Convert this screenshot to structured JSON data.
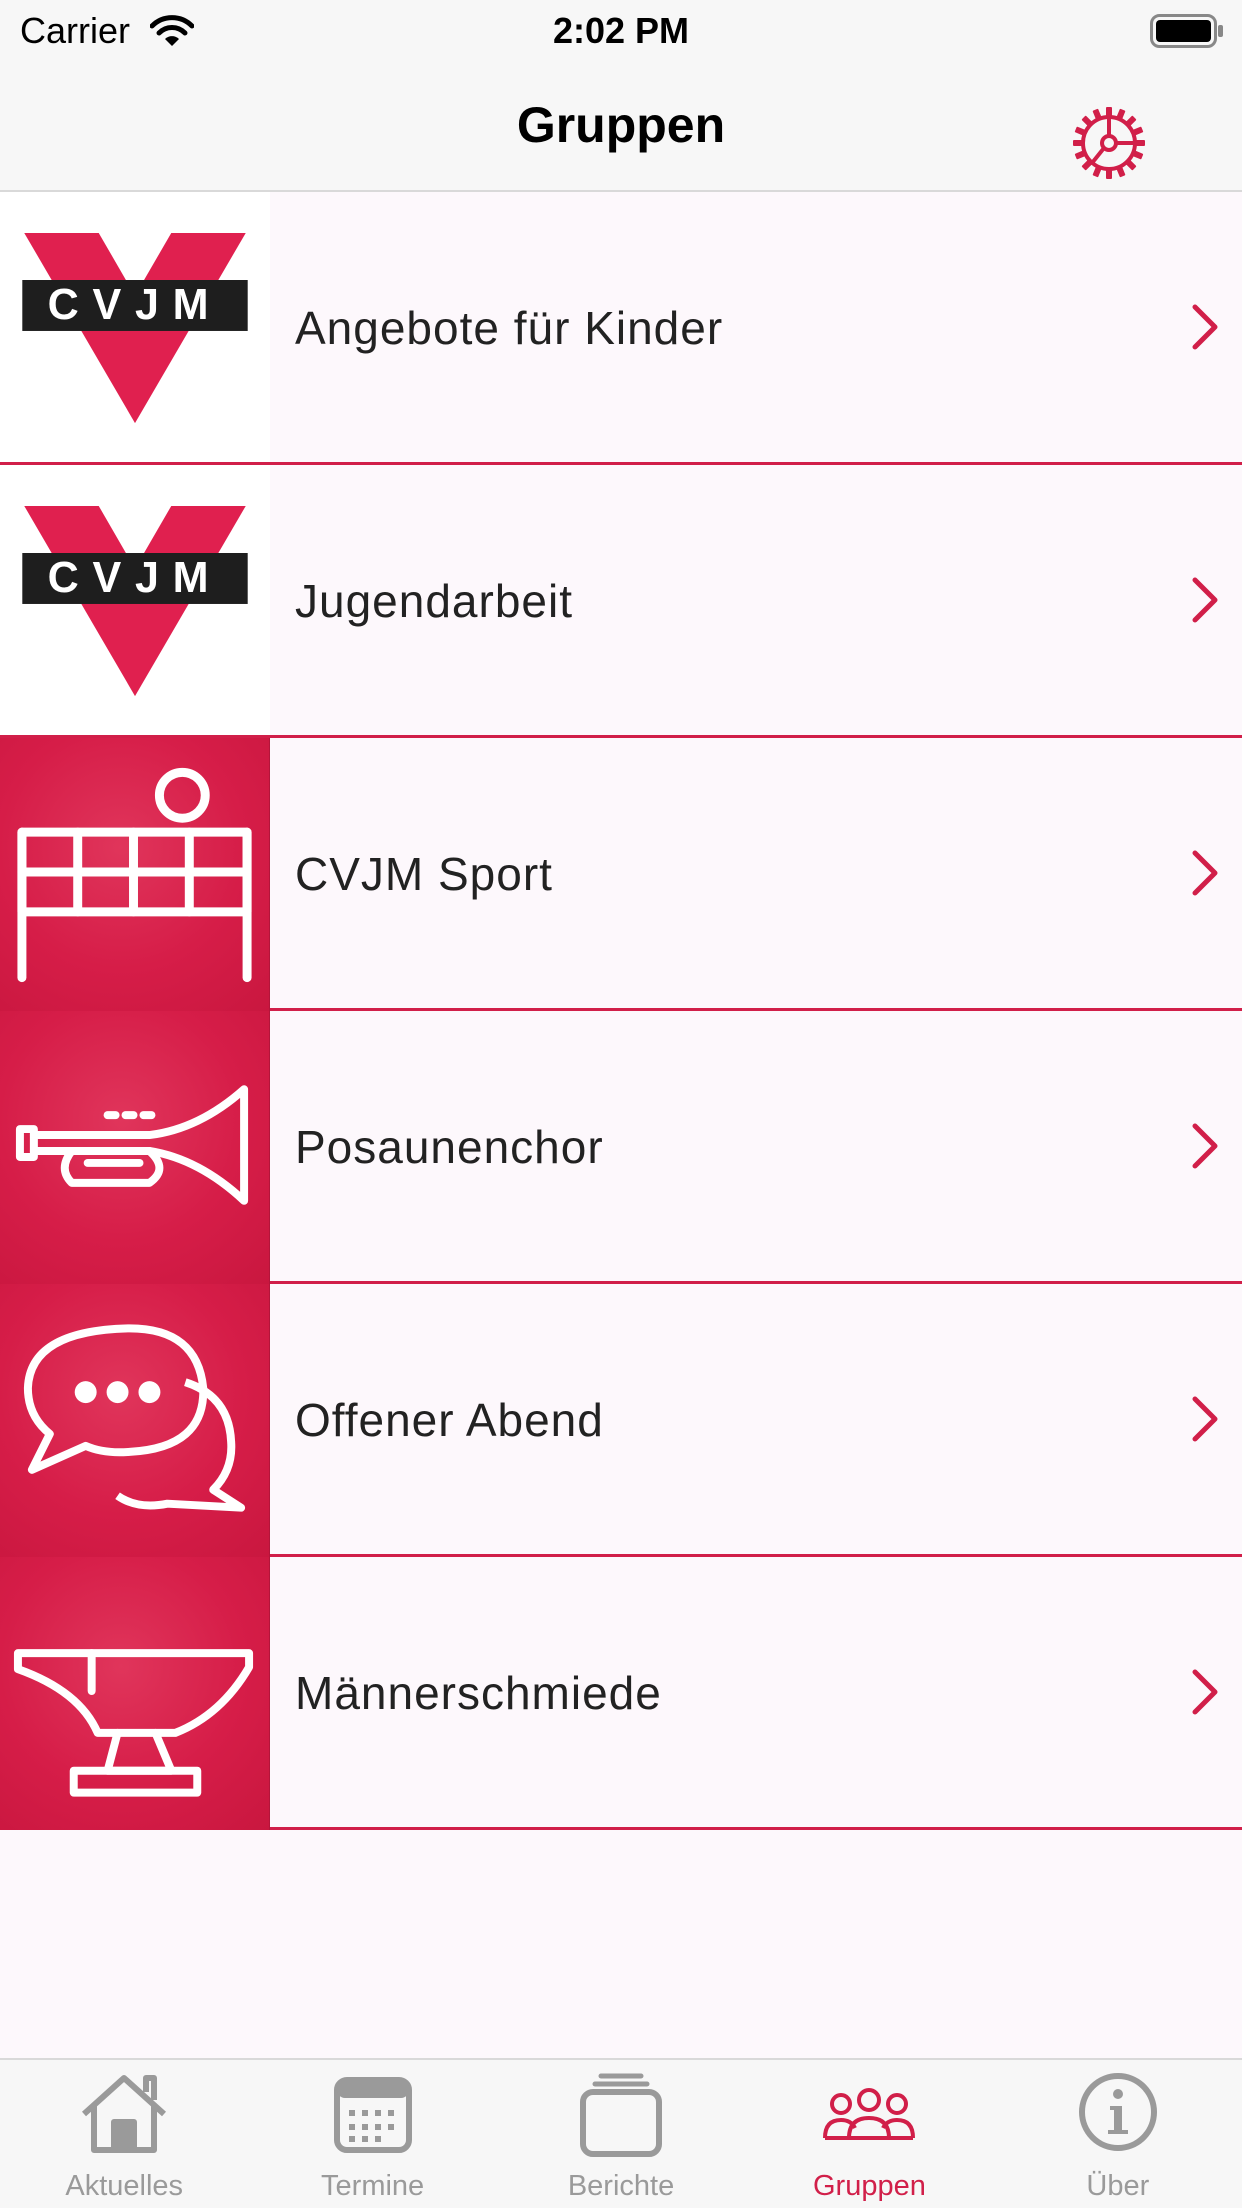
{
  "status": {
    "carrier": "Carrier",
    "time": "2:02 PM"
  },
  "nav": {
    "title": "Gruppen",
    "settings_icon": "gear-icon"
  },
  "colors": {
    "accent": "#d11f49",
    "inactive": "#9a9a9a"
  },
  "groups": [
    {
      "label": "Angebote für Kinder",
      "icon": "cvjm-logo",
      "logo_text": "CVJM"
    },
    {
      "label": "Jugendarbeit",
      "icon": "cvjm-logo",
      "logo_text": "CVJM"
    },
    {
      "label": "CVJM Sport",
      "icon": "volleyball-net-icon"
    },
    {
      "label": "Posaunenchor",
      "icon": "trumpet-icon"
    },
    {
      "label": "Offener Abend",
      "icon": "chat-bubbles-icon"
    },
    {
      "label": "Männerschmiede",
      "icon": "anvil-icon"
    }
  ],
  "tabs": [
    {
      "label": "Aktuelles",
      "icon": "house-icon",
      "active": false
    },
    {
      "label": "Termine",
      "icon": "calendar-icon",
      "active": false
    },
    {
      "label": "Berichte",
      "icon": "stack-icon",
      "active": false
    },
    {
      "label": "Gruppen",
      "icon": "people-icon",
      "active": true
    },
    {
      "label": "Über",
      "icon": "info-icon",
      "active": false
    }
  ]
}
